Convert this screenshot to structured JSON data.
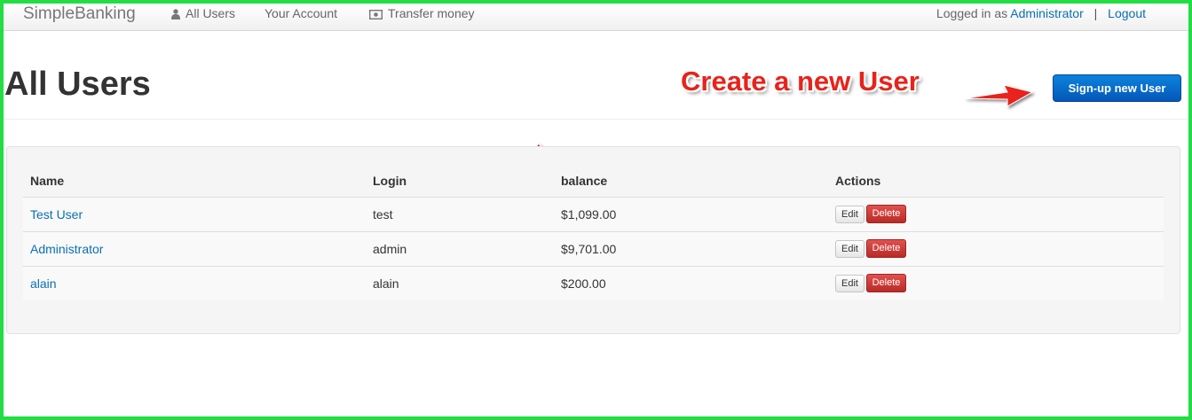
{
  "navbar": {
    "brand": "SimpleBanking",
    "links": [
      {
        "label": "All Users",
        "icon": "user-icon"
      },
      {
        "label": "Your Account"
      },
      {
        "label": "Transfer money",
        "icon": "money-icon"
      }
    ],
    "logged_in_prefix": "Logged in as",
    "user_link": "Administrator",
    "separator": "|",
    "logout": "Logout"
  },
  "page": {
    "title": "All Users",
    "signup_button": "Sign-up new User"
  },
  "annotation": {
    "text": "Create a new User",
    "color": "#e8231b"
  },
  "table": {
    "headers": [
      "Name",
      "Login",
      "balance",
      "Actions"
    ],
    "rows": [
      {
        "name": "Test User",
        "login": "test",
        "balance": "$1,099.00"
      },
      {
        "name": "Administrator",
        "login": "admin",
        "balance": "$9,701.00"
      },
      {
        "name": "alain",
        "login": "alain",
        "balance": "$200.00"
      }
    ],
    "edit_label": "Edit",
    "delete_label": "Delete"
  },
  "colors": {
    "frame": "#22dd44",
    "link": "#0a6fb4",
    "primary_button": "#0557b8",
    "danger_button": "#b92b27"
  }
}
